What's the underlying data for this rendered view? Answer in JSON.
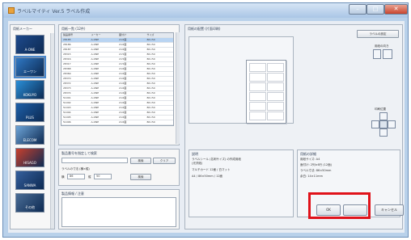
{
  "window": {
    "title": "ラベルマイティ Ver.5 ラベル作成"
  },
  "sidebar": {
    "header": "用紙メーカー",
    "items": [
      {
        "label": "A-ONE",
        "color": "#1e4a8c"
      },
      {
        "label": "エーワン",
        "color": "#2f78c4"
      },
      {
        "label": "KOKUYO",
        "color": "#2a8fd8"
      },
      {
        "label": "PLUS",
        "color": "#1d5fa8"
      },
      {
        "label": "ELECOM",
        "color": "#6ea5d8"
      },
      {
        "label": "HISAGO",
        "color": "#c9402c"
      },
      {
        "label": "SANWA",
        "color": "#355f9c"
      },
      {
        "label": "その他",
        "color": "#4a6d96"
      }
    ]
  },
  "list": {
    "header": "用紙一覧 (12件)",
    "columns": [
      "製品番号",
      "メーカー",
      "面付け",
      "サイズ"
    ],
    "rows": [
      [
        "28185",
        "A-ONE",
        "2×6面",
        "86×50"
      ],
      [
        "28186",
        "A-ONE",
        "2×6面",
        "86×50"
      ],
      [
        "28187",
        "A-ONE",
        "2×6面",
        "86×50"
      ],
      [
        "28315",
        "A-ONE",
        "2×5面",
        "86×50"
      ],
      [
        "28316",
        "A-ONE",
        "2×5面",
        "86×50"
      ],
      [
        "28317",
        "A-ONE",
        "2×5面",
        "86×50"
      ],
      [
        "28368",
        "A-ONE",
        "2×6面",
        "86×50"
      ],
      [
        "28369",
        "A-ONE",
        "2×6面",
        "86×50"
      ],
      [
        "28370",
        "A-ONE",
        "2×6面",
        "86×50"
      ],
      [
        "28372",
        "A-ONE",
        "2×6面",
        "86×50"
      ],
      [
        "28373",
        "A-ONE",
        "2×6面",
        "86×50"
      ],
      [
        "28374",
        "A-ONE",
        "2×6面",
        "86×50"
      ],
      [
        "51001",
        "A-ONE",
        "2×6面",
        "86×50"
      ],
      [
        "51002",
        "A-ONE",
        "2×6面",
        "86×50"
      ],
      [
        "51003",
        "A-ONE",
        "2×6面",
        "86×50"
      ],
      [
        "51004",
        "A-ONE",
        "2×6面",
        "86×50"
      ],
      [
        "51005",
        "A-ONE",
        "2×6面",
        "86×50"
      ],
      [
        "51006",
        "A-ONE",
        "2×6面",
        "86×50"
      ]
    ]
  },
  "search": {
    "header": "製品番号を指定して検索",
    "search_button": "検索",
    "clear_button": "クリア",
    "size_label": "ラベルの寸法 (横×縦)",
    "width_label": "横",
    "height_label": "縦",
    "width_value": "86",
    "height_value": "50",
    "size_button": "検索"
  },
  "notes": {
    "header": "製品情報 / 注意"
  },
  "preview": {
    "header": "用紙の配置 (片面印刷)",
    "settings_button": "ラベルの設定",
    "orientation_label": "用紙の向き",
    "position_label": "印刷位置"
  },
  "info": {
    "header": "説明",
    "lines": [
      "ラベルシール (名刺サイズ) の作成用紙",
      "(光沢紙)",
      "マルチカード 12面 / 白マット",
      "A4 / 86×50mm / 12面"
    ]
  },
  "detail": {
    "header": "用紙の詳細",
    "lines": [
      "用紙サイズ: A4",
      "面付け: 2列×6行 (12面)",
      "ラベル寸法: 86×50mm",
      "余白: 14×11mm"
    ]
  },
  "footer": {
    "ok_button": "OK",
    "cancel_button": "キャンセル"
  }
}
